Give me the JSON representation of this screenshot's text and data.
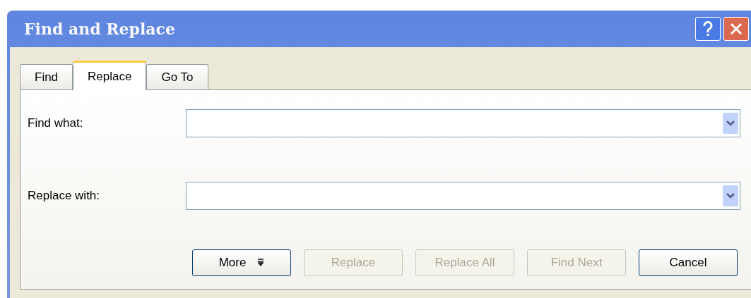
{
  "window": {
    "title": "Find and Replace"
  },
  "tabs": [
    {
      "label": "Find",
      "selected": false
    },
    {
      "label": "Replace",
      "selected": true
    },
    {
      "label": "Go To",
      "selected": false
    }
  ],
  "fields": [
    {
      "label": "Find what:"
    },
    {
      "label": "Replace with:"
    }
  ],
  "buttons": [
    {
      "label": "More",
      "kind": "expand",
      "disabled": false
    },
    {
      "label": "Replace",
      "kind": "plain",
      "disabled": true
    },
    {
      "label": "Replace All",
      "kind": "plain",
      "disabled": true
    },
    {
      "label": "Find Next",
      "kind": "plain",
      "disabled": true
    },
    {
      "label": "Cancel",
      "kind": "plain",
      "disabled": false
    }
  ]
}
